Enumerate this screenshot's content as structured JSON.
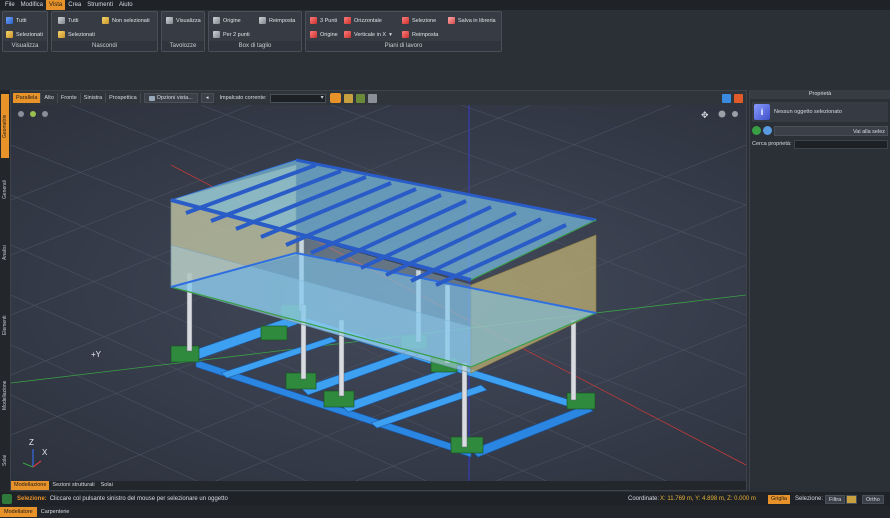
{
  "menu": {
    "items": [
      "File",
      "Modifica",
      "Vista",
      "Crea",
      "Strumenti",
      "Aiuto"
    ],
    "active": "Vista"
  },
  "ribbon": {
    "visualizza": {
      "caption": "Visualizza",
      "tutti": "Tutti",
      "selezionati": "Selezionati"
    },
    "nascondi": {
      "caption": "Nascondi",
      "tutti": "Tutti",
      "non_selezionati": "Non selezionati",
      "selezionati": "Selezionati"
    },
    "tavolozze": {
      "caption": "Tavolozze",
      "visualizza": "Visualizza"
    },
    "box": {
      "caption": "Box di taglio",
      "origine": "Origine",
      "reimposta": "Reimposta",
      "per2": "Per 2 punti"
    },
    "piani": {
      "caption": "Piani di lavoro",
      "tre_punti": "3 Punti",
      "orizzontale": "Orizzontale",
      "selezione": "Selezione",
      "salva": "Salva in libreria",
      "origine": "Origine",
      "verticale": "Verticale in X",
      "reimposta": "Reimposta"
    }
  },
  "left_tabs": [
    "Geometrie",
    "Generali",
    "Analisi",
    "Elementi",
    "Modellazione",
    "Solai"
  ],
  "view": {
    "tabs": [
      "Parallela",
      "Alto",
      "Fronte",
      "Sinistra",
      "Prospettica"
    ],
    "active_tab": "Parallela",
    "options_label": "Opzioni vista...",
    "plane_label": "Impalcato corrente:",
    "axis_y": "+Y",
    "axis_z": "Z",
    "axis_x": "X",
    "bottom_tabs": [
      "Modellazione",
      "Sezioni strutturali",
      "Solai"
    ],
    "active_bottom": "Modellazione"
  },
  "properties": {
    "title": "Proprietà",
    "no_selection": "Nessun oggetto selezionato",
    "goto": "Vai alla selez",
    "search_label": "Cerca proprietà:"
  },
  "status": {
    "label": "Selezione:",
    "message": "Cliccare col pulsante sinistro del mouse per selezionare un oggetto",
    "coord_label": "Coordinate:",
    "coords": "X: 11.769 m,  Y: 4.898 m,  Z: 0.000 m",
    "grid": "Griglia",
    "selection_label": "Selezione:",
    "filter": "Filtra",
    "ortho": "Ortho"
  },
  "workspace": {
    "tabs": [
      "Modellatore",
      "Carpenterie"
    ],
    "active": "Modellatore"
  },
  "colors": {
    "accent": "#e8922a",
    "beam_blue": "#2f6fe0",
    "slab_blue": "#7ec8f0",
    "footing_green": "#2f8a3e"
  }
}
